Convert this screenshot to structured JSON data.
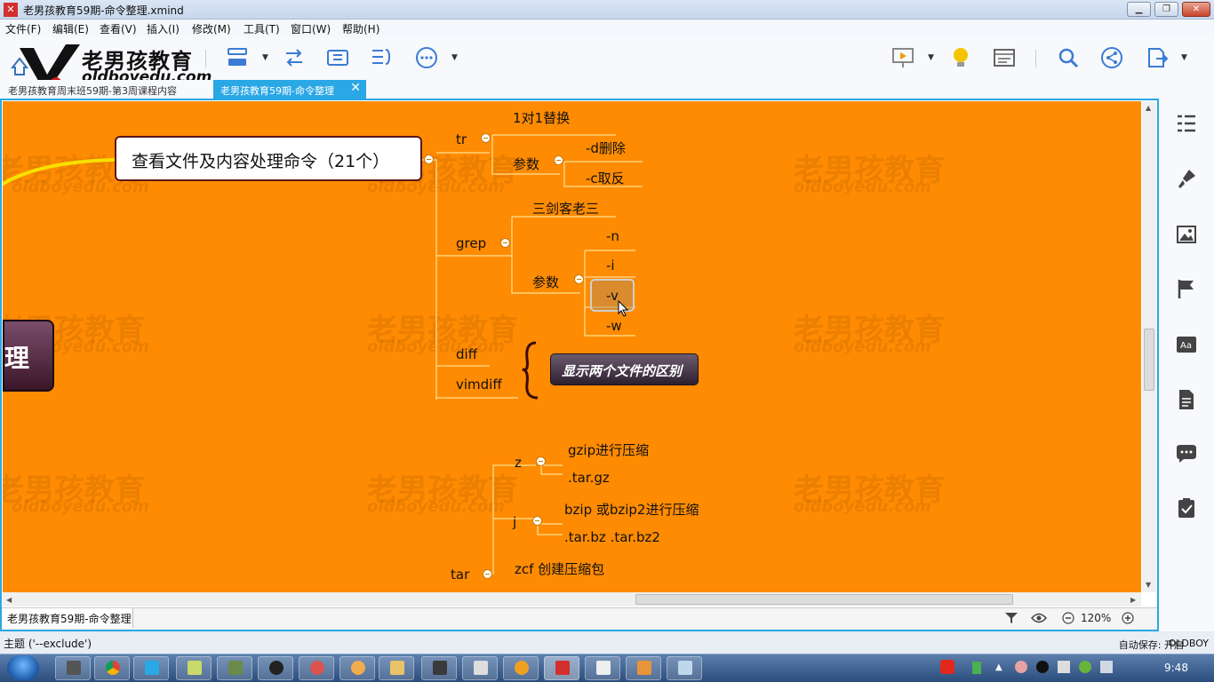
{
  "window": {
    "title": "老男孩教育59期-命令整理.xmind",
    "buttons": {
      "minimize": "▁",
      "maximize": "❐",
      "close": "✕"
    }
  },
  "menu": [
    "文件(F)",
    "编辑(E)",
    "查看(V)",
    "插入(I)",
    "修改(M)",
    "工具(T)",
    "窗口(W)",
    "帮助(H)"
  ],
  "logo": {
    "name": "老男孩教育",
    "url": "oldboyedu.com"
  },
  "tabs": {
    "inactive": "老男孩教育周末班59期-第3周课程内容",
    "active": "老男孩教育59期-命令整理",
    "close": "✕"
  },
  "mindmap": {
    "central_partial": "理",
    "topic": "查看文件及内容处理命令（21个）",
    "tr": {
      "label": "tr",
      "sub1": "1对1替换",
      "param": "参数",
      "opts": [
        "-d删除",
        "-c取反"
      ]
    },
    "grep": {
      "label": "grep",
      "sub1": "三剑客老三",
      "param": "参数",
      "opts": [
        "-n",
        "-i",
        "-v",
        "-w"
      ]
    },
    "diff": "diff",
    "vimdiff": "vimdiff",
    "summary": "显示两个文件的区别",
    "tar": {
      "label": "tar",
      "z": "z",
      "z_items": [
        "gzip进行压缩",
        ".tar.gz"
      ],
      "j": "j",
      "j_items": [
        "bzip 或bzip2进行压缩",
        ".tar.bz   .tar.bz2"
      ],
      "zcf": "zcf 创建压缩包"
    },
    "watermark": {
      "text": "老男孩教育",
      "url": "oldboyedu.com"
    }
  },
  "bottom": {
    "sheet": "老男孩教育59期-命令整理",
    "zoom": "120%"
  },
  "status": {
    "topic": "主题 ('--exclude')",
    "autosave": "自动保存: 开启",
    "user": "OLDBOY"
  },
  "taskbar": {
    "time": "9:48"
  },
  "colors": {
    "canvas": "#fe8b02",
    "accent": "#2aa7e5"
  }
}
